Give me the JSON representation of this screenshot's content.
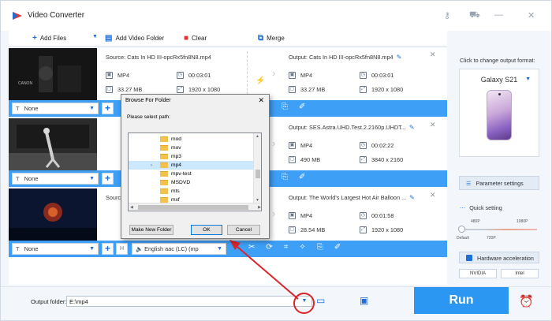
{
  "app": {
    "title": "Video Converter",
    "icons": [
      "key-icon",
      "cart-icon",
      "minimize-icon",
      "close-icon"
    ]
  },
  "toolbar": {
    "add_files": "Add Files",
    "add_video_folder": "Add Video Folder",
    "clear": "Clear",
    "merge": "Merge"
  },
  "items": [
    {
      "source": "Source: Cats In HD III-opcRx5fn8N8.mp4",
      "src_format": "MP4",
      "src_duration": "00:03:01",
      "src_size": "33.27 MB",
      "src_res": "1920 x 1080",
      "output": "Output: Cats In HD III-opcRx5fn8N8.mp4",
      "out_format": "MP4",
      "out_duration": "00:03:01",
      "out_size": "33.27 MB",
      "out_res": "1920 x 1080",
      "subtitle": "None"
    },
    {
      "source": "",
      "src_format": "",
      "src_duration": "",
      "src_size": "",
      "src_res": "",
      "output": "Output: SES.Astra.UHD.Test.2.2160p.UHDT...",
      "out_format": "MP4",
      "out_duration": "00:02:22",
      "out_size": "490 MB",
      "out_res": "3840 x 2160",
      "subtitle": "None"
    },
    {
      "source": "Sourc",
      "src_format": "",
      "src_duration": "",
      "src_size": "",
      "src_res": "",
      "output": "Output: The World's Largest Hot Air Balloon ...",
      "out_format": "MP4",
      "out_duration": "00:01:58",
      "out_size": "28.54 MB",
      "out_res": "1920 x 1080",
      "subtitle": "None",
      "audio": "English aac (LC) (mp"
    }
  ],
  "right_panel": {
    "title": "Click to change output format:",
    "device": "Galaxy S21",
    "parameter_settings": "Parameter settings",
    "quick_setting": "Quick setting",
    "ticks_top": [
      "480P",
      "1080P"
    ],
    "ticks_bottom": [
      "Default",
      "720P"
    ],
    "quick_setting_level": 0.0,
    "hw_accel": "Hardware acceleration",
    "badges": [
      "NVIDIA",
      "Intel"
    ]
  },
  "bottom": {
    "output_folder_label": "Output folder:",
    "output_folder_value": "E:\\mp4",
    "run_label": "Run"
  },
  "dialog": {
    "title": "Browse For Folder",
    "subtitle": "Please select path:",
    "folders": [
      "mod",
      "mov",
      "mp3",
      "mp4",
      "mpv-test",
      "MSDVD",
      "mts",
      "mxf"
    ],
    "selected": "mp4",
    "make_new_folder": "Make New Folder",
    "ok": "OK",
    "cancel": "Cancel"
  },
  "colors": {
    "accent": "#3d9ff5",
    "run": "#2b97f2",
    "annotation": "#d9262b"
  }
}
